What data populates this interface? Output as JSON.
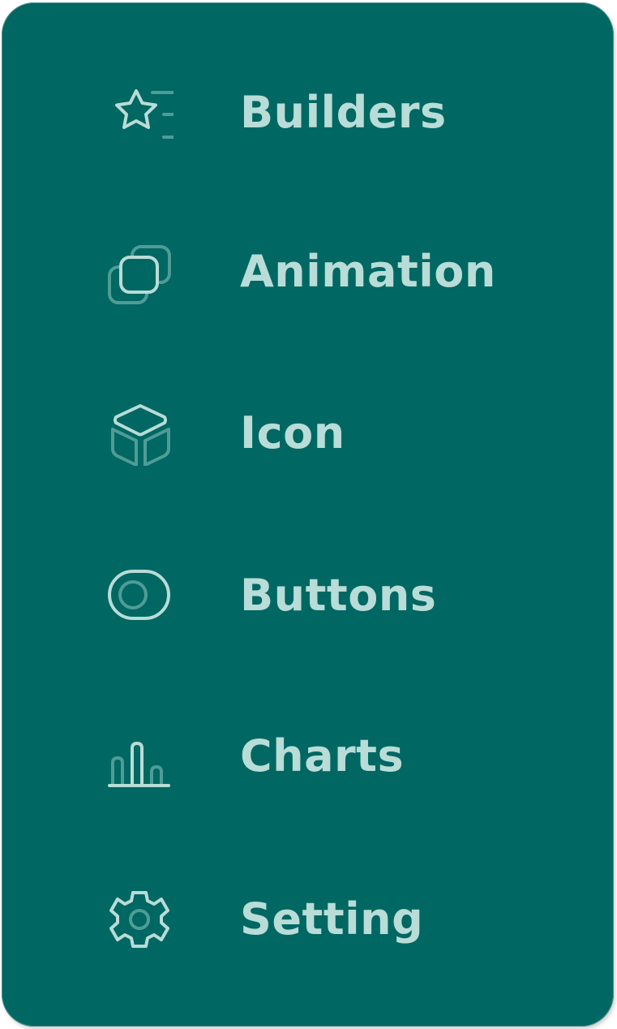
{
  "theme": {
    "panel_bg": "#006762",
    "text_color": "#b8dcd7",
    "icon_color": "#b8dcd7",
    "icon_muted_color": "#4f9c97"
  },
  "menu": {
    "items": [
      {
        "label": "Builders",
        "icon": "star-list-icon"
      },
      {
        "label": "Animation",
        "icon": "stacked-squares-icon"
      },
      {
        "label": "Icon",
        "icon": "cube-icon"
      },
      {
        "label": "Buttons",
        "icon": "toggle-icon"
      },
      {
        "label": "Charts",
        "icon": "bar-chart-icon"
      },
      {
        "label": "Setting",
        "icon": "gear-icon"
      }
    ]
  }
}
